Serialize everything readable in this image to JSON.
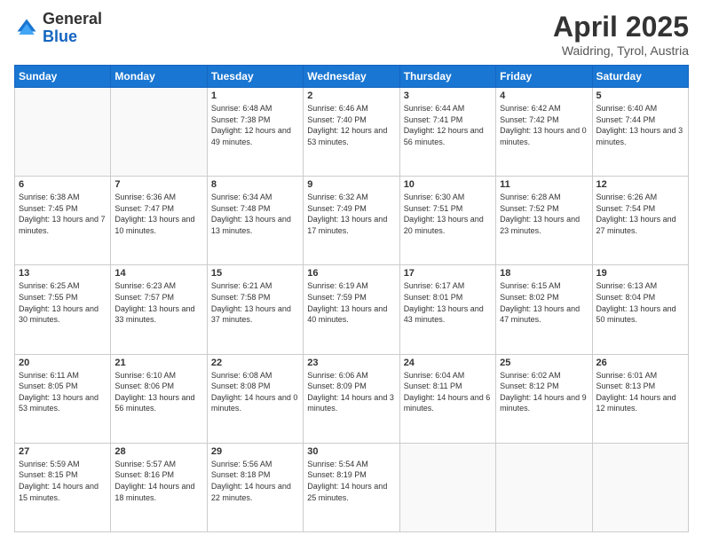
{
  "header": {
    "logo_general": "General",
    "logo_blue": "Blue",
    "main_title": "April 2025",
    "sub_title": "Waidring, Tyrol, Austria"
  },
  "weekdays": [
    "Sunday",
    "Monday",
    "Tuesday",
    "Wednesday",
    "Thursday",
    "Friday",
    "Saturday"
  ],
  "weeks": [
    [
      {
        "day": "",
        "empty": true
      },
      {
        "day": "",
        "empty": true
      },
      {
        "day": "1",
        "sunrise": "Sunrise: 6:48 AM",
        "sunset": "Sunset: 7:38 PM",
        "daylight": "Daylight: 12 hours and 49 minutes."
      },
      {
        "day": "2",
        "sunrise": "Sunrise: 6:46 AM",
        "sunset": "Sunset: 7:40 PM",
        "daylight": "Daylight: 12 hours and 53 minutes."
      },
      {
        "day": "3",
        "sunrise": "Sunrise: 6:44 AM",
        "sunset": "Sunset: 7:41 PM",
        "daylight": "Daylight: 12 hours and 56 minutes."
      },
      {
        "day": "4",
        "sunrise": "Sunrise: 6:42 AM",
        "sunset": "Sunset: 7:42 PM",
        "daylight": "Daylight: 13 hours and 0 minutes."
      },
      {
        "day": "5",
        "sunrise": "Sunrise: 6:40 AM",
        "sunset": "Sunset: 7:44 PM",
        "daylight": "Daylight: 13 hours and 3 minutes."
      }
    ],
    [
      {
        "day": "6",
        "sunrise": "Sunrise: 6:38 AM",
        "sunset": "Sunset: 7:45 PM",
        "daylight": "Daylight: 13 hours and 7 minutes."
      },
      {
        "day": "7",
        "sunrise": "Sunrise: 6:36 AM",
        "sunset": "Sunset: 7:47 PM",
        "daylight": "Daylight: 13 hours and 10 minutes."
      },
      {
        "day": "8",
        "sunrise": "Sunrise: 6:34 AM",
        "sunset": "Sunset: 7:48 PM",
        "daylight": "Daylight: 13 hours and 13 minutes."
      },
      {
        "day": "9",
        "sunrise": "Sunrise: 6:32 AM",
        "sunset": "Sunset: 7:49 PM",
        "daylight": "Daylight: 13 hours and 17 minutes."
      },
      {
        "day": "10",
        "sunrise": "Sunrise: 6:30 AM",
        "sunset": "Sunset: 7:51 PM",
        "daylight": "Daylight: 13 hours and 20 minutes."
      },
      {
        "day": "11",
        "sunrise": "Sunrise: 6:28 AM",
        "sunset": "Sunset: 7:52 PM",
        "daylight": "Daylight: 13 hours and 23 minutes."
      },
      {
        "day": "12",
        "sunrise": "Sunrise: 6:26 AM",
        "sunset": "Sunset: 7:54 PM",
        "daylight": "Daylight: 13 hours and 27 minutes."
      }
    ],
    [
      {
        "day": "13",
        "sunrise": "Sunrise: 6:25 AM",
        "sunset": "Sunset: 7:55 PM",
        "daylight": "Daylight: 13 hours and 30 minutes."
      },
      {
        "day": "14",
        "sunrise": "Sunrise: 6:23 AM",
        "sunset": "Sunset: 7:57 PM",
        "daylight": "Daylight: 13 hours and 33 minutes."
      },
      {
        "day": "15",
        "sunrise": "Sunrise: 6:21 AM",
        "sunset": "Sunset: 7:58 PM",
        "daylight": "Daylight: 13 hours and 37 minutes."
      },
      {
        "day": "16",
        "sunrise": "Sunrise: 6:19 AM",
        "sunset": "Sunset: 7:59 PM",
        "daylight": "Daylight: 13 hours and 40 minutes."
      },
      {
        "day": "17",
        "sunrise": "Sunrise: 6:17 AM",
        "sunset": "Sunset: 8:01 PM",
        "daylight": "Daylight: 13 hours and 43 minutes."
      },
      {
        "day": "18",
        "sunrise": "Sunrise: 6:15 AM",
        "sunset": "Sunset: 8:02 PM",
        "daylight": "Daylight: 13 hours and 47 minutes."
      },
      {
        "day": "19",
        "sunrise": "Sunrise: 6:13 AM",
        "sunset": "Sunset: 8:04 PM",
        "daylight": "Daylight: 13 hours and 50 minutes."
      }
    ],
    [
      {
        "day": "20",
        "sunrise": "Sunrise: 6:11 AM",
        "sunset": "Sunset: 8:05 PM",
        "daylight": "Daylight: 13 hours and 53 minutes."
      },
      {
        "day": "21",
        "sunrise": "Sunrise: 6:10 AM",
        "sunset": "Sunset: 8:06 PM",
        "daylight": "Daylight: 13 hours and 56 minutes."
      },
      {
        "day": "22",
        "sunrise": "Sunrise: 6:08 AM",
        "sunset": "Sunset: 8:08 PM",
        "daylight": "Daylight: 14 hours and 0 minutes."
      },
      {
        "day": "23",
        "sunrise": "Sunrise: 6:06 AM",
        "sunset": "Sunset: 8:09 PM",
        "daylight": "Daylight: 14 hours and 3 minutes."
      },
      {
        "day": "24",
        "sunrise": "Sunrise: 6:04 AM",
        "sunset": "Sunset: 8:11 PM",
        "daylight": "Daylight: 14 hours and 6 minutes."
      },
      {
        "day": "25",
        "sunrise": "Sunrise: 6:02 AM",
        "sunset": "Sunset: 8:12 PM",
        "daylight": "Daylight: 14 hours and 9 minutes."
      },
      {
        "day": "26",
        "sunrise": "Sunrise: 6:01 AM",
        "sunset": "Sunset: 8:13 PM",
        "daylight": "Daylight: 14 hours and 12 minutes."
      }
    ],
    [
      {
        "day": "27",
        "sunrise": "Sunrise: 5:59 AM",
        "sunset": "Sunset: 8:15 PM",
        "daylight": "Daylight: 14 hours and 15 minutes."
      },
      {
        "day": "28",
        "sunrise": "Sunrise: 5:57 AM",
        "sunset": "Sunset: 8:16 PM",
        "daylight": "Daylight: 14 hours and 18 minutes."
      },
      {
        "day": "29",
        "sunrise": "Sunrise: 5:56 AM",
        "sunset": "Sunset: 8:18 PM",
        "daylight": "Daylight: 14 hours and 22 minutes."
      },
      {
        "day": "30",
        "sunrise": "Sunrise: 5:54 AM",
        "sunset": "Sunset: 8:19 PM",
        "daylight": "Daylight: 14 hours and 25 minutes."
      },
      {
        "day": "",
        "empty": true
      },
      {
        "day": "",
        "empty": true
      },
      {
        "day": "",
        "empty": true
      }
    ]
  ]
}
